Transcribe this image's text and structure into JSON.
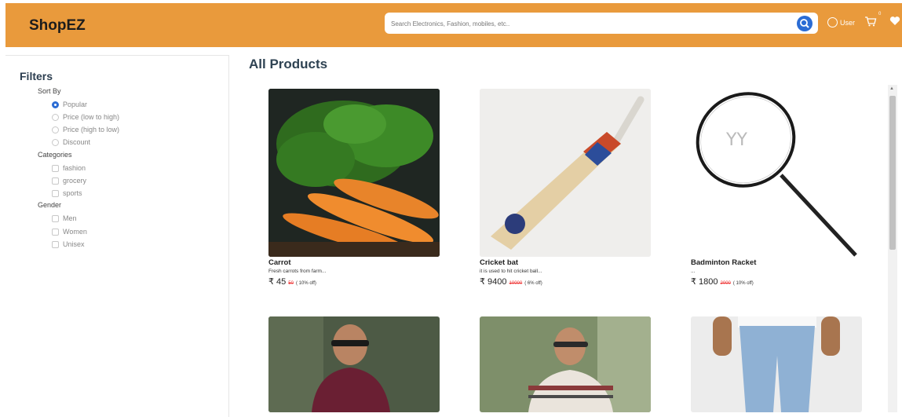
{
  "header": {
    "brand": "ShopEZ",
    "search_placeholder": "Search Electronics, Fashion, mobiles, etc..",
    "user_label": "User",
    "cart_count": "0",
    "icons": [
      "search-icon",
      "user-icon",
      "cart-icon",
      "heart-icon"
    ]
  },
  "filters": {
    "title": "Filters",
    "sort_by": {
      "label": "Sort By",
      "options": [
        "Popular",
        "Price (low to high)",
        "Price (high to low)",
        "Discount"
      ],
      "selected": "Popular"
    },
    "categories": {
      "label": "Categories",
      "options": [
        "fashion",
        "grocery",
        "sports"
      ]
    },
    "gender": {
      "label": "Gender",
      "options": [
        "Men",
        "Women",
        "Unisex"
      ]
    }
  },
  "main": {
    "title": "All Products",
    "products": [
      {
        "title": "Carrot",
        "desc": "Fresh carrots from farm...",
        "price": "₹ 45",
        "old_price": "50",
        "discount": "( 10% off)"
      },
      {
        "title": "Cricket bat",
        "desc": "it is used to hit cricket ball...",
        "price": "₹ 9400",
        "old_price": "10000",
        "discount": "( 6% off)"
      },
      {
        "title": "Badminton Racket",
        "desc": "...",
        "price": "₹ 1800",
        "old_price": "2000",
        "discount": "( 10% off)"
      },
      {
        "title": "",
        "desc": "",
        "price": "",
        "old_price": "",
        "discount": ""
      },
      {
        "title": "",
        "desc": "",
        "price": "",
        "old_price": "",
        "discount": ""
      },
      {
        "title": "",
        "desc": "",
        "price": "",
        "old_price": "",
        "discount": ""
      }
    ]
  },
  "colors": {
    "navbar": "#e99a3c",
    "accent": "#2b6cd4",
    "strike_price": "#e33333"
  }
}
